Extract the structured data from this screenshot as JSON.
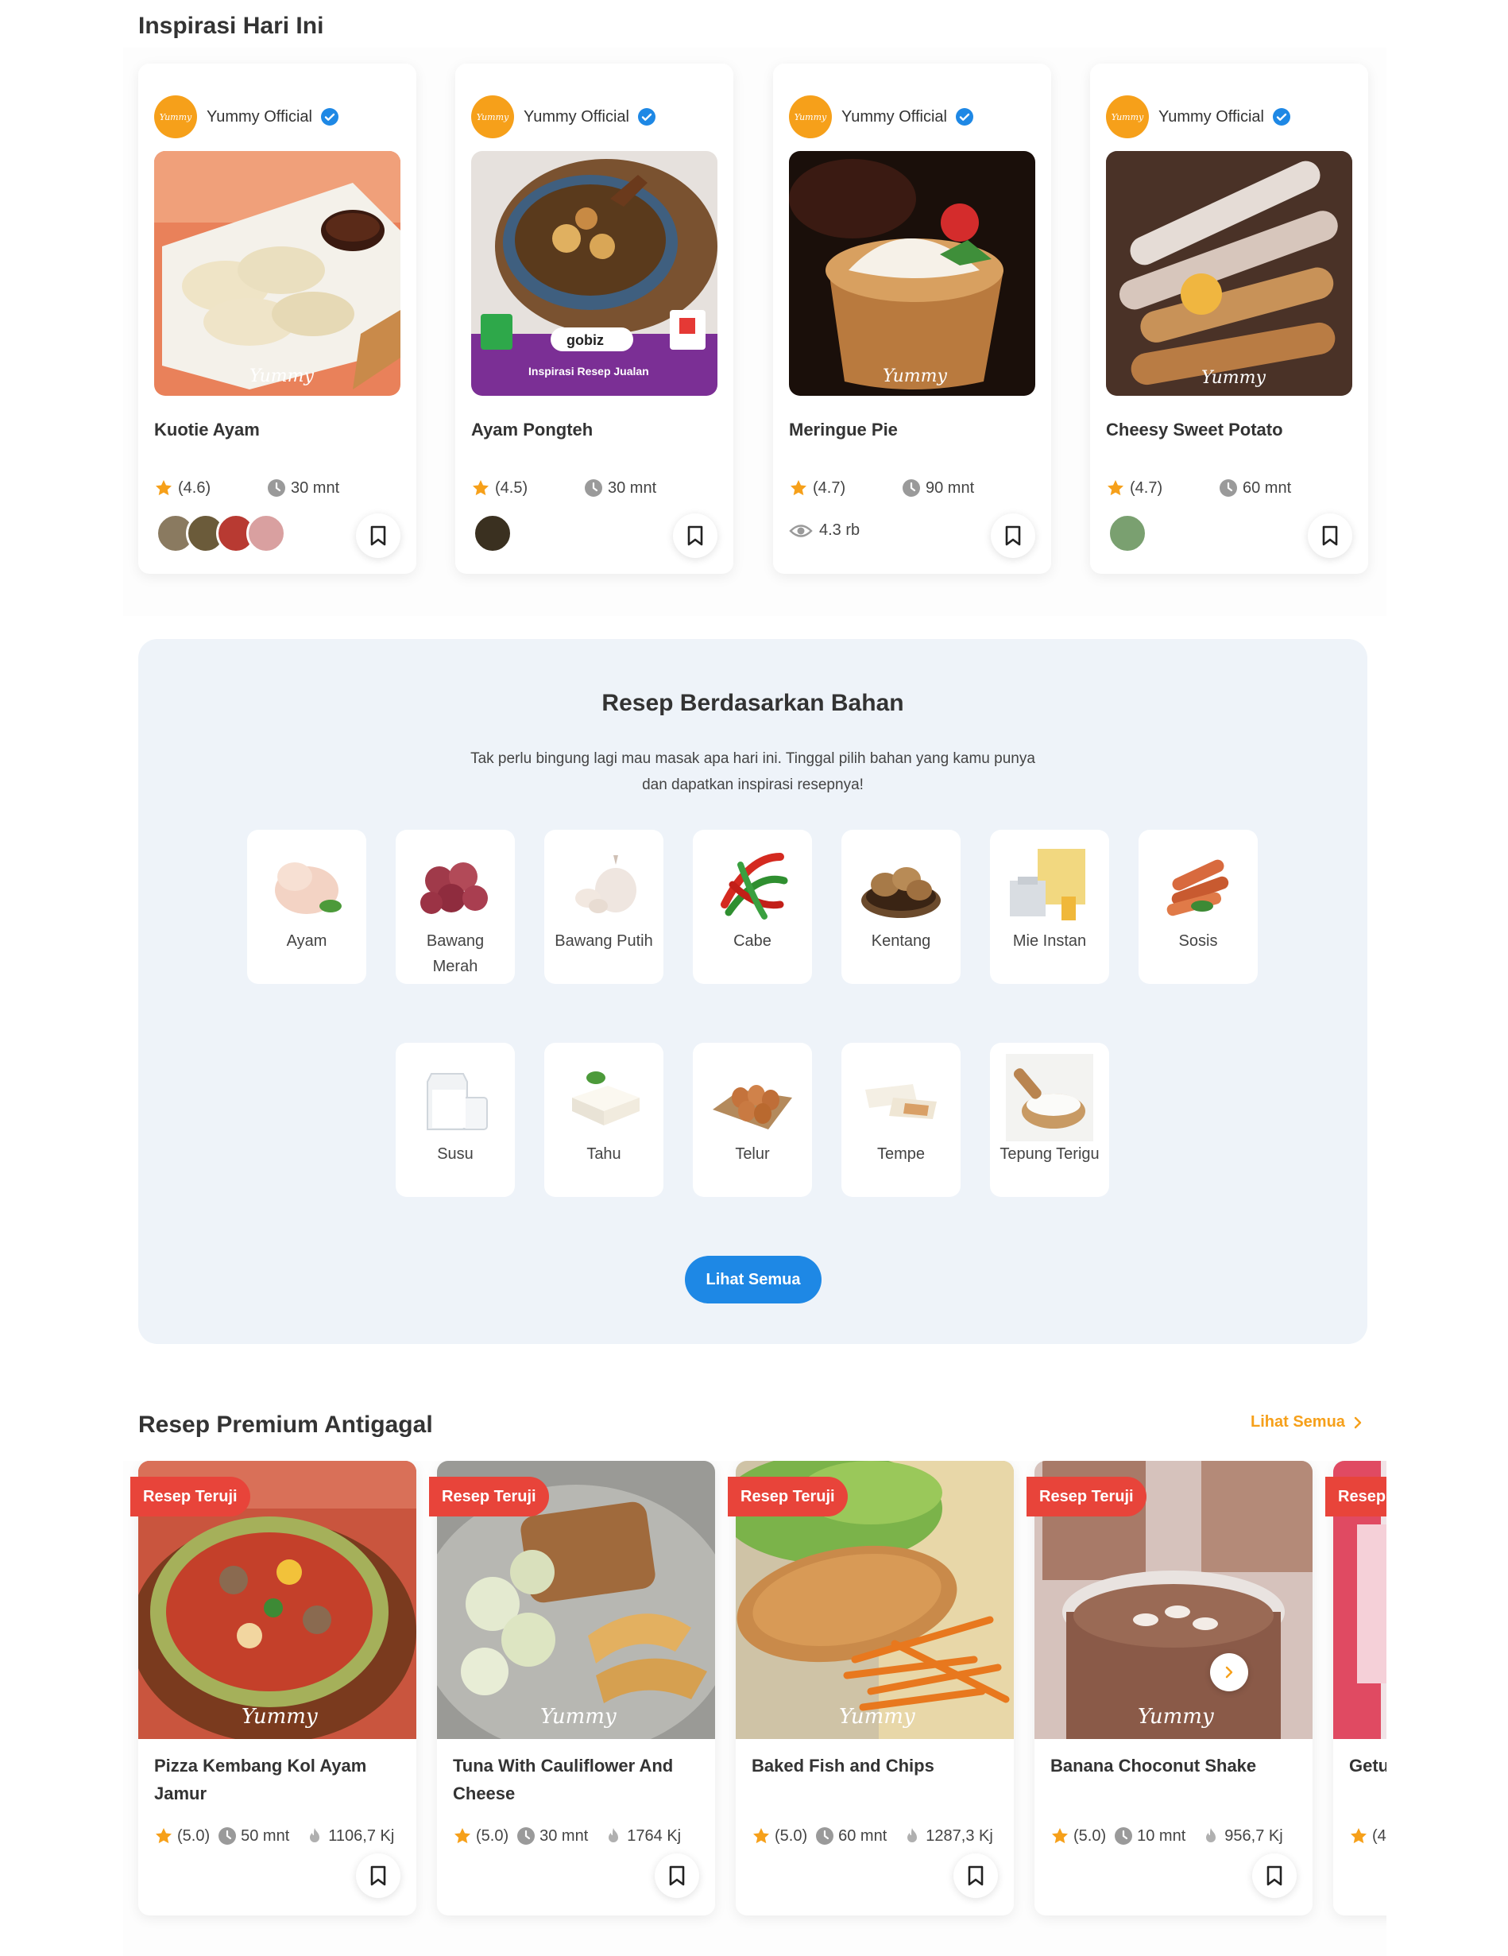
{
  "colors": {
    "accent_orange": "#f6a01a",
    "primary_blue": "#1e88e5",
    "badge_red": "#e8443a",
    "section_bg": "#eef3f9"
  },
  "inspirasi": {
    "title": "Inspirasi Hari Ini",
    "cards": [
      {
        "author": "Yummy Official",
        "title": "Kuotie Ayam",
        "rating": "(4.6)",
        "time": "30 mnt"
      },
      {
        "author": "Yummy Official",
        "title": "Ayam Pongteh",
        "rating": "(4.5)",
        "time": "30 mnt"
      },
      {
        "author": "Yummy Official",
        "title": "Meringue Pie",
        "rating": "(4.7)",
        "time": "90 mnt",
        "views": "4.3 rb"
      },
      {
        "author": "Yummy Official",
        "title": "Cheesy Sweet Potato",
        "rating": "(4.7)",
        "time": "60 mnt"
      }
    ],
    "logo_text": "Yummy"
  },
  "bahan": {
    "title": "Resep Berdasarkan Bahan",
    "subtitle": "Tak perlu bingung lagi mau masak apa hari ini. Tinggal pilih bahan yang kamu punya dan dapatkan inspirasi resepnya!",
    "items": [
      {
        "name": "Ayam",
        "icon": "chicken-icon"
      },
      {
        "name": "Bawang Merah",
        "icon": "shallot-icon"
      },
      {
        "name": "Bawang Putih",
        "icon": "garlic-icon"
      },
      {
        "name": "Cabe",
        "icon": "chili-icon"
      },
      {
        "name": "Kentang",
        "icon": "potato-icon"
      },
      {
        "name": "Mie Instan",
        "icon": "noodle-icon"
      },
      {
        "name": "Sosis",
        "icon": "sausage-icon"
      },
      {
        "name": "Susu",
        "icon": "milk-icon"
      },
      {
        "name": "Tahu",
        "icon": "tofu-icon"
      },
      {
        "name": "Telur",
        "icon": "egg-icon"
      },
      {
        "name": "Tempe",
        "icon": "tempeh-icon"
      },
      {
        "name": "Tepung Terigu",
        "icon": "flour-icon"
      }
    ],
    "button_label": "Lihat Semua"
  },
  "premium": {
    "title": "Resep Premium Antigagal",
    "see_all": "Lihat Semua",
    "cards": [
      {
        "badge": "Resep Teruji",
        "title": "Pizza Kembang Kol Ayam Jamur",
        "rating": "(5.0)",
        "time": "50 mnt",
        "energy": "1106,7 Kj"
      },
      {
        "badge": "Resep Teruji",
        "title": "Tuna With Cauliflower And Cheese",
        "rating": "(5.0)",
        "time": "30 mnt",
        "energy": "1764 Kj"
      },
      {
        "badge": "Resep Teruji",
        "title": "Baked Fish and Chips",
        "rating": "(5.0)",
        "time": "60 mnt",
        "energy": "1287,3 Kj"
      },
      {
        "badge": "Resep Teruji",
        "title": "Banana Choconut Shake",
        "rating": "(5.0)",
        "time": "10 mnt",
        "energy": "956,7 Kj"
      },
      {
        "badge": "Resep Teruji",
        "title": "Getu",
        "rating": "(4",
        "time": "",
        "energy": ""
      }
    ]
  }
}
